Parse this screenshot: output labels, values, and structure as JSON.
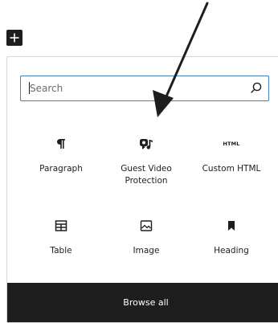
{
  "toolbar": {
    "add_block_icon": "plus-icon"
  },
  "inserter": {
    "search": {
      "placeholder": "Search",
      "value": "",
      "icon": "search-icon"
    },
    "blocks": [
      {
        "label": "Paragraph",
        "icon": "paragraph-icon"
      },
      {
        "label": "Guest Video Protection",
        "icon": "video-protection-icon"
      },
      {
        "label": "Custom HTML",
        "icon": "html-icon",
        "icon_text": "HTML"
      },
      {
        "label": "Table",
        "icon": "table-icon"
      },
      {
        "label": "Image",
        "icon": "image-icon"
      },
      {
        "label": "Heading",
        "icon": "bookmark-icon"
      }
    ],
    "browse_all_label": "Browse all"
  },
  "annotation": {
    "icon": "annotation-arrow-icon"
  }
}
